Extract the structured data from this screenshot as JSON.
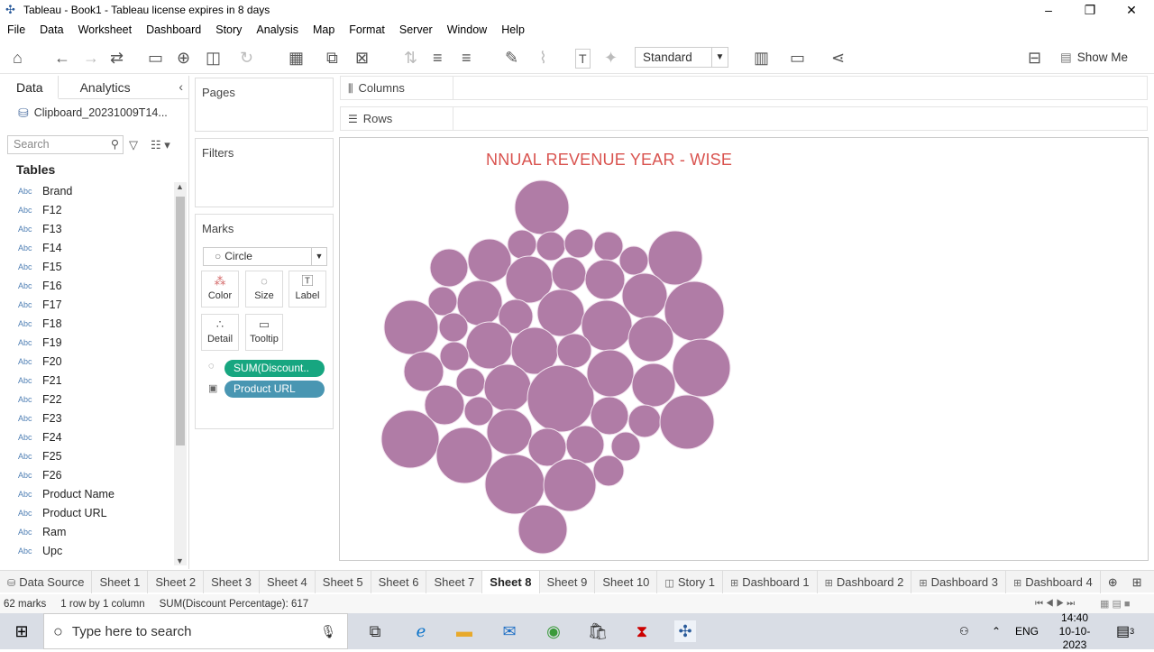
{
  "window": {
    "title": "Tableau - Book1 - Tableau license expires in 8 days",
    "minimize": "–",
    "restore": "❐",
    "close": "✕"
  },
  "menu": [
    "File",
    "Data",
    "Worksheet",
    "Dashboard",
    "Story",
    "Analysis",
    "Map",
    "Format",
    "Server",
    "Window",
    "Help"
  ],
  "toolbar": {
    "fit_mode": "Standard",
    "show_me": "Show Me"
  },
  "left_pane": {
    "tabs": {
      "data": "Data",
      "analytics": "Analytics"
    },
    "data_source": "Clipboard_20231009T14...",
    "search_placeholder": "Search",
    "tables_heading": "Tables",
    "type_label": "Abc",
    "fields": [
      "Brand",
      "F12",
      "F13",
      "F14",
      "F15",
      "F16",
      "F17",
      "F18",
      "F19",
      "F20",
      "F21",
      "F22",
      "F23",
      "F24",
      "F25",
      "F26",
      "Product Name",
      "Product URL",
      "Ram",
      "Upc"
    ]
  },
  "cards": {
    "pages": "Pages",
    "filters": "Filters",
    "marks": "Marks",
    "mark_type": "Circle",
    "buttons": {
      "color": "Color",
      "size": "Size",
      "label": "Label",
      "detail": "Detail",
      "tooltip": "Tooltip"
    },
    "pills": [
      {
        "label": "SUM(Discount..",
        "color": "#17a680"
      },
      {
        "label": "Product URL",
        "color": "#4996b2"
      }
    ]
  },
  "shelves": {
    "columns": "Columns",
    "rows": "Rows"
  },
  "viz": {
    "title": "NNUAL REVENUE YEAR - WISE",
    "bubble_color": "#b07ca6",
    "title_color": "#d9534f"
  },
  "sheet_tabs": {
    "data_source": "Data Source",
    "sheets": [
      "Sheet 1",
      "Sheet 2",
      "Sheet 3",
      "Sheet 4",
      "Sheet 5",
      "Sheet 6",
      "Sheet 7",
      "Sheet 8",
      "Sheet 9",
      "Sheet 10"
    ],
    "active": "Sheet 8",
    "story": "Story 1",
    "dashboards": [
      "Dashboard 1",
      "Dashboard 2",
      "Dashboard 3",
      "Dashboard 4"
    ]
  },
  "status": {
    "marks": "62 marks",
    "layout": "1 row by 1 column",
    "sum": "SUM(Discount Percentage): 617"
  },
  "taskbar": {
    "search_placeholder": "Type here to search",
    "lang": "ENG",
    "time": "14:40",
    "date": "10-10-2023",
    "notif_count": "3"
  }
}
